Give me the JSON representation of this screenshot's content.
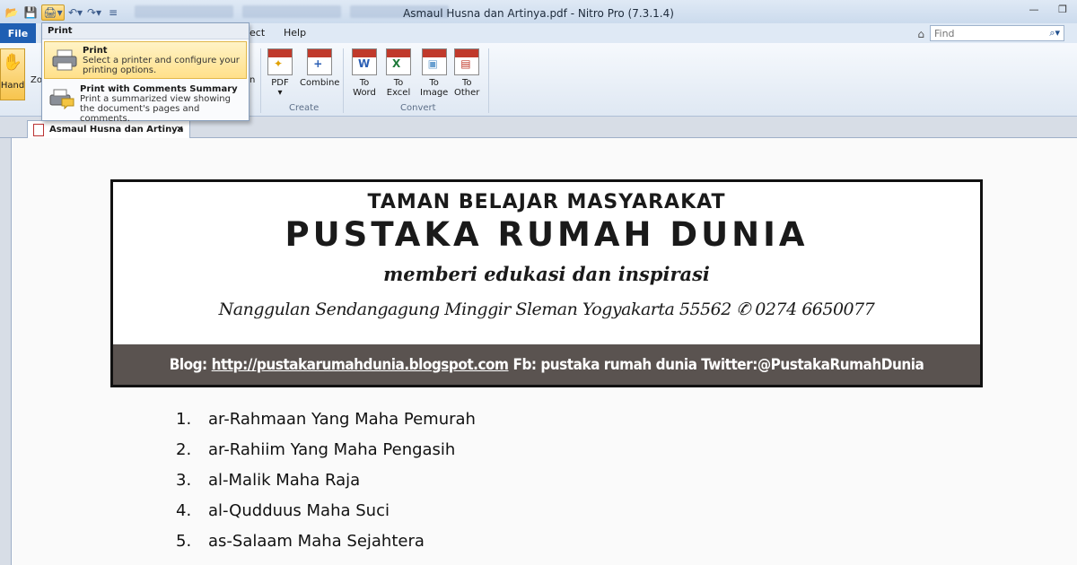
{
  "window": {
    "title": "Asmaul Husna dan Artinya.pdf - Nitro Pro (7.3.1.4)"
  },
  "ribbon": {
    "file_tab": "File",
    "tabs_visible": [
      "ect",
      "Help"
    ],
    "find_placeholder": "Find",
    "hand_label": "Hand",
    "zoom_label_partial": "Zo",
    "partial_label": "n",
    "buttons": [
      {
        "label": "PDF",
        "icon": "pdf-create-icon"
      },
      {
        "label": "Combine",
        "icon": "combine-icon"
      },
      {
        "label": "To\nWord",
        "icon": "to-word-icon"
      },
      {
        "label": "To\nExcel",
        "icon": "to-excel-icon"
      },
      {
        "label": "To\nImage",
        "icon": "to-image-icon"
      },
      {
        "label": "To\nOther",
        "icon": "to-other-icon"
      }
    ],
    "groups": [
      "Create",
      "Convert"
    ],
    "brand_colors": {
      "word": "#2b5fb4",
      "excel": "#1e7a3a",
      "image": "#6aa0d0",
      "other": "#c0392b"
    }
  },
  "print_menu": {
    "title": "Print",
    "items": [
      {
        "label": "Print",
        "desc": "Select a printer and configure your printing options."
      },
      {
        "label": "Print with Comments Summary",
        "desc": "Print a summarized view showing the document's pages and comments."
      }
    ]
  },
  "doc_tab": {
    "label": "Asmaul Husna dan Artinya",
    "close": "×"
  },
  "document": {
    "banner": {
      "line1": "TAMAN BELAJAR MASYARAKAT",
      "line2": "PUSTAKA RUMAH DUNIA",
      "slogan": "memberi edukasi dan inspirasi",
      "address": "Nanggulan Sendangagung Minggir Sleman Yogyakarta 55562  ✆ 0274 6650077",
      "blog_prefix": "Blog:",
      "blog_url": "http://pustakarumahdunia.blogspot.com",
      "social": "Fb: pustaka rumah dunia Twitter:@PustakaRumahDunia"
    },
    "list": [
      {
        "num": "1.",
        "text": "ar-Rahmaan Yang Maha Pemurah"
      },
      {
        "num": "2.",
        "text": "ar-Rahiim Yang Maha Pengasih"
      },
      {
        "num": "3.",
        "text": "al-Malik Maha Raja"
      },
      {
        "num": "4.",
        "text": "al-Qudduus Maha Suci"
      },
      {
        "num": "5.",
        "text": "as-Salaam Maha Sejahtera"
      }
    ]
  }
}
